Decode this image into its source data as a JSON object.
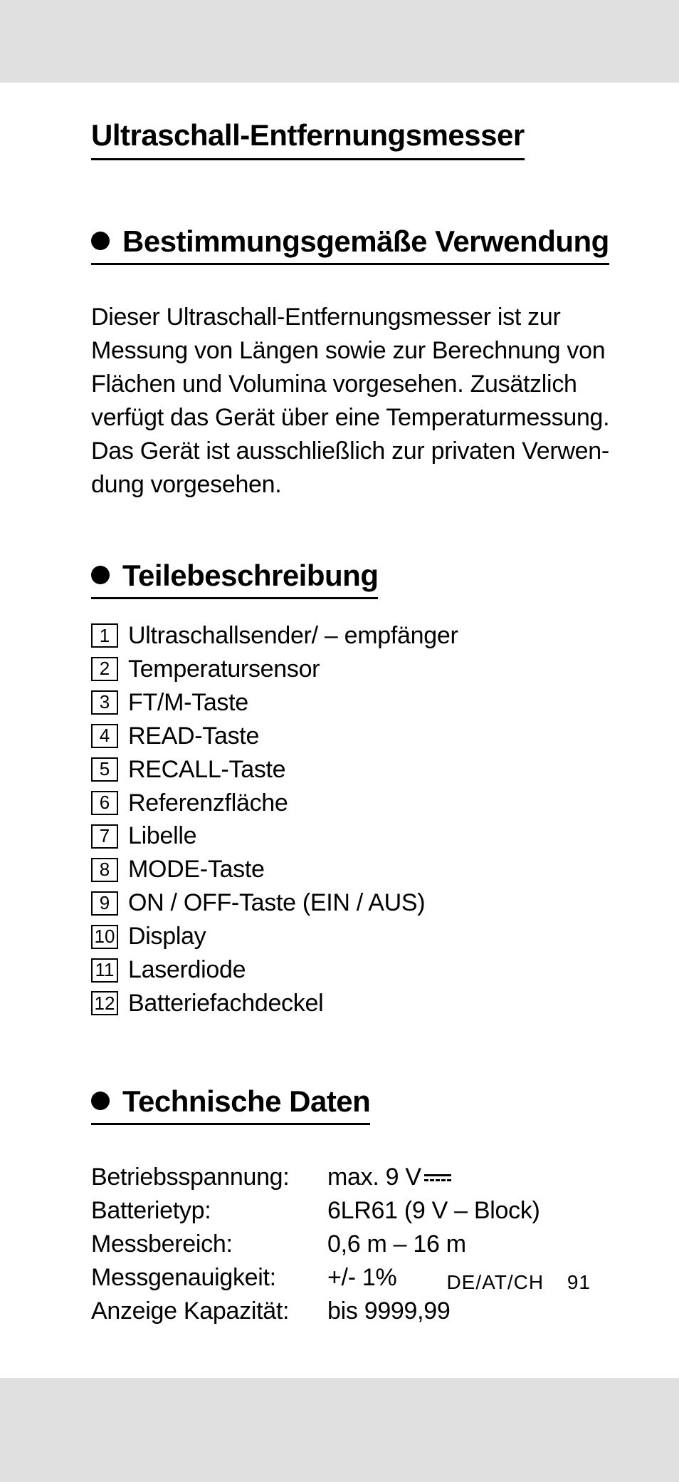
{
  "title": "Ultraschall-Entfernungsmesser",
  "sections": {
    "intended_use": {
      "heading": "Bestimmungsgemäße Verwendung",
      "body": "Dieser Ultraschall-Entfernungsmesser ist zur Messung von Längen sowie zur Berechnung von Flächen und Volumina vorgesehen. Zusätzlich verfügt das Gerät über eine Temperaturmessung. Das Gerät ist ausschließlich zur privaten Verwen­dung vorgesehen."
    },
    "parts": {
      "heading": "Teilebeschreibung",
      "items": [
        {
          "num": "1",
          "label": "Ultraschallsender/ – empfänger"
        },
        {
          "num": "2",
          "label": "Temperatursensor"
        },
        {
          "num": "3",
          "label": "FT/M-Taste"
        },
        {
          "num": "4",
          "label": "READ-Taste"
        },
        {
          "num": "5",
          "label": "RECALL-Taste"
        },
        {
          "num": "6",
          "label": "Referenzfläche"
        },
        {
          "num": "7",
          "label": "Libelle"
        },
        {
          "num": "8",
          "label": "MODE-Taste"
        },
        {
          "num": "9",
          "label": "ON / OFF-Taste (EIN / AUS)"
        },
        {
          "num": "10",
          "label": "Display"
        },
        {
          "num": "11",
          "label": "Laserdiode"
        },
        {
          "num": "12",
          "label": "Batteriefachdeckel"
        }
      ]
    },
    "specs": {
      "heading": "Technische Daten",
      "rows": [
        {
          "label": "Betriebsspannung:",
          "value": "max. 9 V",
          "dc": true
        },
        {
          "label": "Batterietyp:",
          "value": "6LR61 (9 V – Block)"
        },
        {
          "label": "Messbereich:",
          "value": "0,6 m – 16 m"
        },
        {
          "label": "Messgenauigkeit:",
          "value": "+/- 1%"
        },
        {
          "label": "Anzeige Kapazität:",
          "value": "bis 9999,99"
        }
      ]
    }
  },
  "footer": {
    "region": "DE/AT/CH",
    "page": "91"
  }
}
